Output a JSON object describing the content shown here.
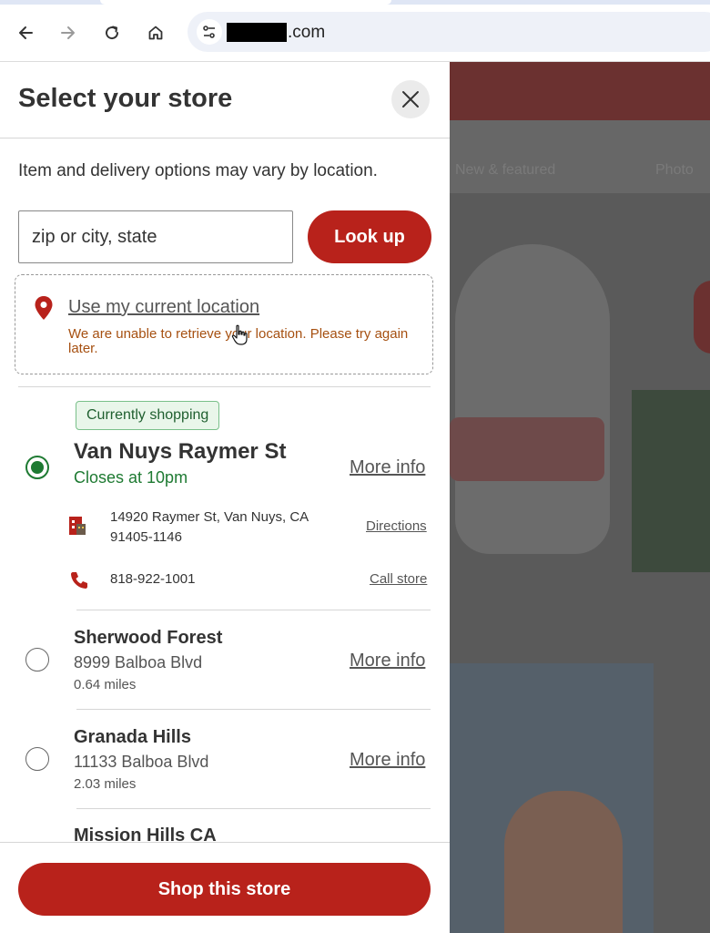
{
  "browser": {
    "url_suffix": ".com",
    "back_icon": "arrow-left-icon",
    "forward_icon": "arrow-right-icon",
    "reload_icon": "reload-icon",
    "home_icon": "home-icon",
    "site_info_icon": "tune-icon"
  },
  "background_page": {
    "nav_items": [
      "New & featured",
      "Photo"
    ]
  },
  "panel": {
    "title": "Select your store",
    "intro": "Item and delivery options may vary by location.",
    "search": {
      "placeholder": "zip or city, state",
      "value": ""
    },
    "lookup_label": "Look up",
    "use_location_label": "Use my current location",
    "location_error": "We are unable to retrieve your location. Please try again later.",
    "current_store": {
      "badge": "Currently shopping",
      "name": "Van Nuys Raymer St",
      "hours": "Closes at 10pm",
      "more_info": "More info",
      "address_line1": "14920 Raymer St, Van Nuys, CA",
      "address_line2": "91405-1146",
      "directions_label": "Directions",
      "phone": "818-922-1001",
      "call_label": "Call store",
      "selected": true
    },
    "stores": [
      {
        "name": "Sherwood Forest",
        "address": "8999 Balboa Blvd",
        "distance": "0.64 miles",
        "more_info": "More info"
      },
      {
        "name": "Granada Hills",
        "address": "11133 Balboa Blvd",
        "distance": "2.03 miles",
        "more_info": "More info"
      },
      {
        "name": "Mission Hills CA",
        "address": "",
        "distance": "",
        "more_info": ""
      }
    ],
    "shop_button_label": "Shop this store"
  },
  "colors": {
    "brand_red": "#b8221b",
    "success_green": "#1e7a32",
    "warning_text": "#a65011"
  }
}
